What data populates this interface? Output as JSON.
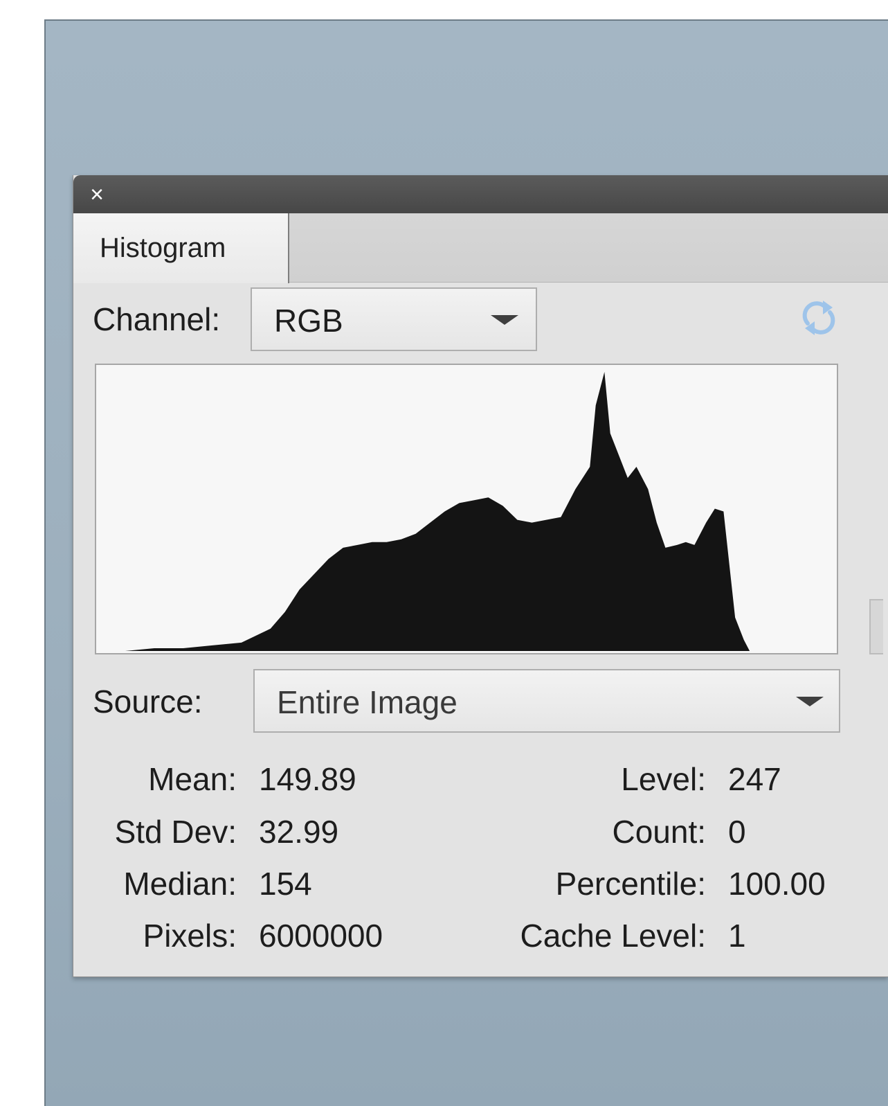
{
  "panel": {
    "close_glyph": "×",
    "tab_label": "Histogram"
  },
  "channel": {
    "label": "Channel:",
    "value": "RGB"
  },
  "source": {
    "label": "Source:",
    "value": "Entire Image"
  },
  "stats_left": [
    {
      "label": "Mean:",
      "value": "149.89"
    },
    {
      "label": "Std Dev:",
      "value": "32.99"
    },
    {
      "label": "Median:",
      "value": "154"
    },
    {
      "label": "Pixels:",
      "value": "6000000"
    }
  ],
  "stats_right": [
    {
      "label": "Level:",
      "value": "247"
    },
    {
      "label": "Count:",
      "value": "0"
    },
    {
      "label": "Percentile:",
      "value": "100.00"
    },
    {
      "label": "Cache Level:",
      "value": "1"
    }
  ],
  "icons": {
    "close": "close-icon",
    "dropdown_caret": "chevron-down-icon",
    "refresh": "refresh-icon"
  },
  "colors": {
    "histogram_fill": "#141414",
    "refresh_icon": "#9ec4ea"
  },
  "chart_data": {
    "type": "area",
    "x": [
      0,
      10,
      20,
      30,
      40,
      50,
      60,
      65,
      70,
      80,
      85,
      90,
      95,
      100,
      105,
      110,
      115,
      120,
      125,
      130,
      135,
      140,
      145,
      150,
      155,
      160,
      165,
      170,
      172,
      175,
      177,
      180,
      183,
      186,
      190,
      193,
      196,
      200,
      203,
      206,
      210,
      213,
      216,
      220,
      223,
      225,
      230,
      232,
      240,
      255
    ],
    "values": [
      0,
      0,
      1,
      1,
      2,
      3,
      8,
      14,
      22,
      33,
      37,
      38,
      39,
      39,
      40,
      42,
      46,
      50,
      53,
      54,
      55,
      52,
      47,
      46,
      47,
      48,
      58,
      66,
      88,
      100,
      78,
      70,
      62,
      66,
      58,
      46,
      37,
      38,
      39,
      38,
      46,
      51,
      50,
      12,
      4,
      0,
      0,
      0,
      0,
      0
    ],
    "xlim": [
      0,
      255
    ],
    "ylim": [
      0,
      100
    ],
    "grid": false
  }
}
